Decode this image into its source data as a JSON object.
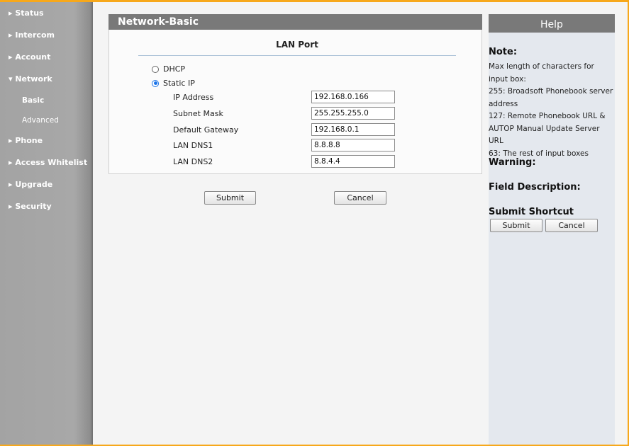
{
  "sidebar": {
    "items": [
      {
        "label": "▸ Status"
      },
      {
        "label": "▸ Intercom"
      },
      {
        "label": "▸ Account"
      },
      {
        "label": "▾ Network"
      },
      {
        "label": "Basic"
      },
      {
        "label": "Advanced"
      },
      {
        "label": "▸ Phone"
      },
      {
        "label": "▸ Access Whitelist"
      },
      {
        "label": "▸ Upgrade"
      },
      {
        "label": "▸ Security"
      }
    ]
  },
  "main": {
    "title": "Network-Basic",
    "section_title": "LAN Port",
    "dhcp_label": "DHCP",
    "static_ip_label": "Static IP",
    "selected_mode": "Static IP",
    "fields": [
      {
        "label": "IP Address",
        "value": "192.168.0.166"
      },
      {
        "label": "Subnet Mask",
        "value": "255.255.255.0"
      },
      {
        "label": "Default Gateway",
        "value": "192.168.0.1"
      },
      {
        "label": "LAN DNS1",
        "value": "8.8.8.8"
      },
      {
        "label": "LAN DNS2",
        "value": "8.8.4.4"
      }
    ],
    "submit_label": "Submit",
    "cancel_label": "Cancel"
  },
  "help": {
    "title": "Help",
    "note_heading": "Note:",
    "note_lines": [
      "Max length of characters for input box:",
      "255: Broadsoft Phonebook server address",
      "127: Remote Phonebook URL & AUTOP Manual Update Server URL",
      "63: The rest of input boxes"
    ],
    "warning_heading": "Warning:",
    "field_desc_heading": "Field Description:",
    "shortcut_heading": "Submit Shortcut",
    "submit_label": "Submit",
    "cancel_label": "Cancel"
  }
}
